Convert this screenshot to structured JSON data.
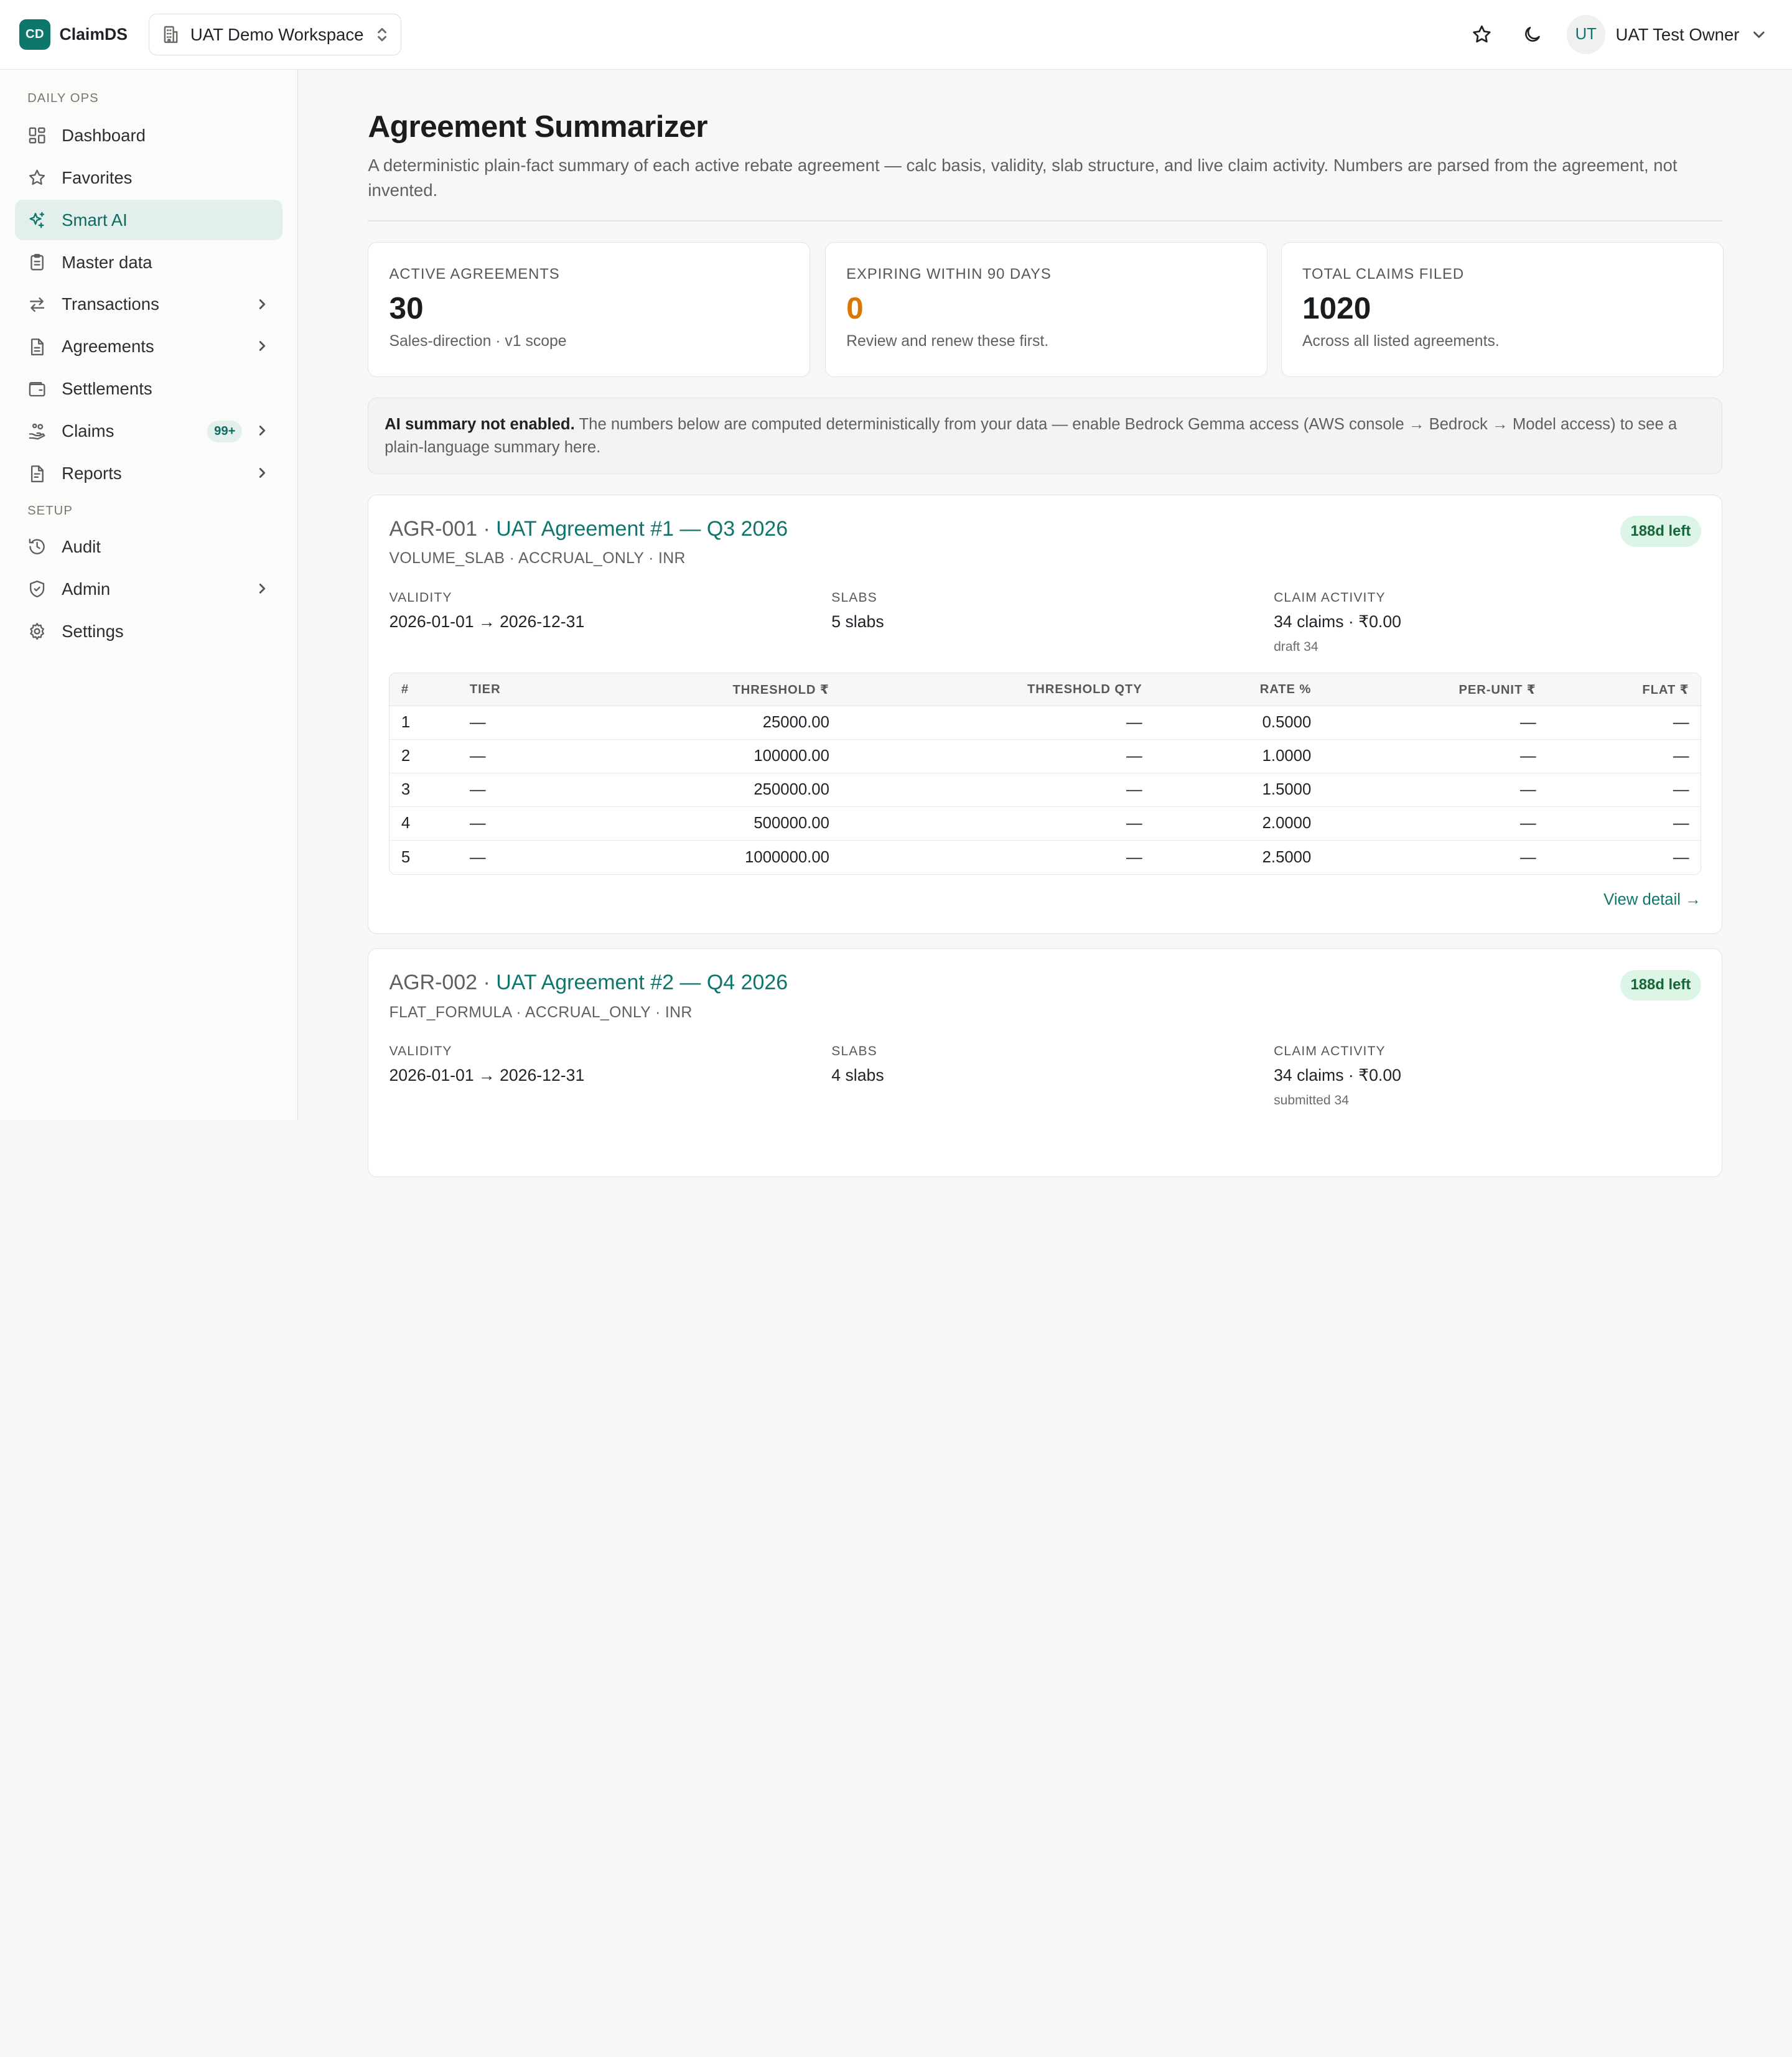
{
  "app": {
    "logo_text": "CD",
    "brand": "ClaimDS",
    "workspace": "UAT Demo Workspace",
    "user_initials": "UT",
    "user_name": "UAT Test Owner"
  },
  "sidebar": {
    "section_daily": "DAILY OPS",
    "section_setup": "SETUP",
    "items": [
      {
        "label": "Dashboard",
        "icon": "dashboard-icon"
      },
      {
        "label": "Favorites",
        "icon": "star-icon"
      },
      {
        "label": "Smart AI",
        "icon": "sparkles-icon",
        "active": true
      },
      {
        "label": "Master data",
        "icon": "clipboard-icon"
      },
      {
        "label": "Transactions",
        "icon": "swap-icon",
        "has_children": true
      },
      {
        "label": "Agreements",
        "icon": "document-icon",
        "has_children": true
      },
      {
        "label": "Settlements",
        "icon": "wallet-icon"
      },
      {
        "label": "Claims",
        "icon": "hand-coins-icon",
        "has_children": true,
        "badge": "99+"
      },
      {
        "label": "Reports",
        "icon": "report-icon",
        "has_children": true
      },
      {
        "label": "Audit",
        "icon": "history-icon"
      },
      {
        "label": "Admin",
        "icon": "shield-icon",
        "has_children": true
      },
      {
        "label": "Settings",
        "icon": "gear-icon"
      }
    ]
  },
  "page": {
    "title": "Agreement Summarizer",
    "description": "A deterministic plain-fact summary of each active rebate agreement — calc basis, validity, slab structure, and live claim activity. Numbers are parsed from the agreement, not invented."
  },
  "stats": [
    {
      "label": "ACTIVE AGREEMENTS",
      "value": "30",
      "sub": "Sales-direction · v1 scope"
    },
    {
      "label": "EXPIRING WITHIN 90 DAYS",
      "value": "0",
      "sub": "Review and renew these first."
    },
    {
      "label": "TOTAL CLAIMS FILED",
      "value": "1020",
      "sub": "Across all listed agreements."
    }
  ],
  "notice": {
    "strong": "AI summary not enabled.",
    "text": " The numbers below are computed deterministically from your data — enable Bedrock Gemma access (AWS console → Bedrock → Model access) to see a plain-language summary here."
  },
  "table_headers": [
    "#",
    "TIER",
    "THRESHOLD ₹",
    "THRESHOLD QTY",
    "RATE %",
    "PER-UNIT ₹",
    "FLAT ₹"
  ],
  "agreements": [
    {
      "code": "AGR-001 · ",
      "name": "UAT Agreement #1 — Q3 2026",
      "days_left": "188d left",
      "meta": "VOLUME_SLAB · ACCRUAL_ONLY · INR",
      "validity_label": "VALIDITY",
      "validity": "2026-01-01 → 2026-12-31",
      "slabs_label": "SLABS",
      "slabs": "5 slabs",
      "claims_label": "CLAIM ACTIVITY",
      "claims": "34 claims · ₹0.00",
      "claims_sub": "draft 34",
      "rows": [
        [
          "1",
          "—",
          "25000.00",
          "—",
          "0.5000",
          "—",
          "—"
        ],
        [
          "2",
          "—",
          "100000.00",
          "—",
          "1.0000",
          "—",
          "—"
        ],
        [
          "3",
          "—",
          "250000.00",
          "—",
          "1.5000",
          "—",
          "—"
        ],
        [
          "4",
          "—",
          "500000.00",
          "—",
          "2.0000",
          "—",
          "—"
        ],
        [
          "5",
          "—",
          "1000000.00",
          "—",
          "2.5000",
          "—",
          "—"
        ]
      ],
      "view_detail": "View detail →"
    },
    {
      "code": "AGR-002 · ",
      "name": "UAT Agreement #2 — Q4 2026",
      "days_left": "188d left",
      "meta": "FLAT_FORMULA · ACCRUAL_ONLY · INR",
      "validity_label": "VALIDITY",
      "validity": "2026-01-01 → 2026-12-31",
      "slabs_label": "SLABS",
      "slabs": "4 slabs",
      "claims_label": "CLAIM ACTIVITY",
      "claims": "34 claims · ₹0.00",
      "claims_sub": "submitted 34"
    }
  ],
  "colors": {
    "accent": "#0f766e",
    "warn": "#d97706",
    "pill_bg": "#dcf5e6",
    "pill_text": "#17663a"
  }
}
